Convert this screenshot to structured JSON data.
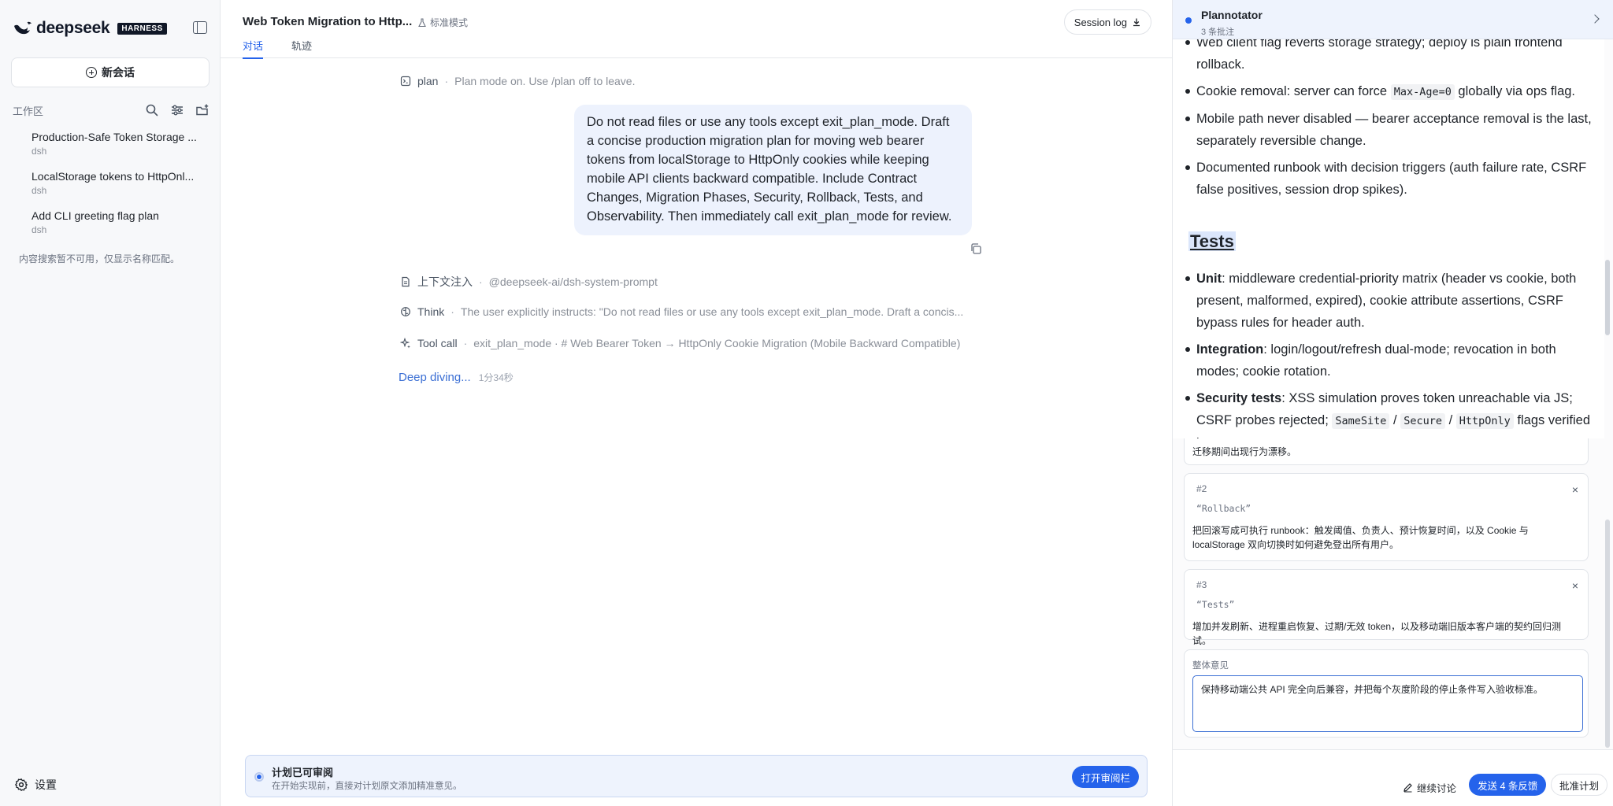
{
  "sidebar": {
    "brand_name": "deepseek",
    "brand_badge": "HARNESS",
    "new_chat_label": "新会话",
    "workspace_label": "工作区",
    "sessions": [
      {
        "title": "Production-Safe Token Storage ...",
        "sub": "dsh"
      },
      {
        "title": "LocalStorage tokens to HttpOnl...",
        "sub": "dsh"
      },
      {
        "title": "Add CLI greeting flag plan",
        "sub": "dsh"
      }
    ],
    "search_note": "内容搜索暂不可用，仅显示名称匹配。",
    "settings_label": "设置"
  },
  "main": {
    "title": "Web Token Migration to Http...",
    "mode": "标准模式",
    "session_log": "Session log",
    "tabs": [
      {
        "label": "对话"
      },
      {
        "label": "轨迹"
      }
    ],
    "plan": {
      "tag": "plan",
      "text": "Plan mode on. Use /plan off to leave."
    },
    "user_message": "Do not read files or use any tools except exit_plan_mode. Draft a concise production migration plan for moving web bearer tokens from localStorage to HttpOnly cookies while keeping mobile API clients backward compatible. Include Contract Changes, Migration Phases, Security, Rollback, Tests, and Observability. Then immediately call exit_plan_mode for review.",
    "steps": [
      {
        "tag": "上下文注入",
        "value": "@deepseek-ai/dsh-system-prompt"
      },
      {
        "tag": "Think",
        "value": "The user explicitly instructs: \"Do not read files or use any tools except exit_plan_mode. Draft a concis..."
      },
      {
        "tag": "Tool call",
        "value": "exit_plan_mode · # Web Bearer Token → HttpOnly Cookie Migration (Mobile Backward Compatible)"
      }
    ],
    "deep_label": "Deep diving...",
    "deep_time": "1分34秒",
    "review": {
      "title": "计划已可审阅",
      "sub": "在开始实现前，直接对计划原文添加精准意见。",
      "button": "打开审阅栏"
    }
  },
  "panel": {
    "title": "Plannotator",
    "sub": "3 条批注",
    "doc": {
      "rollback_items": [
        {
          "text": "Web client flag reverts storage strategy; deploy is plain frontend rollback."
        },
        {
          "pre": "Cookie removal: server can force ",
          "code": "Max-Age=0",
          "post": " globally via ops flag."
        },
        {
          "text": "Mobile path never disabled — bearer acceptance removal is the last, separately reversible change."
        },
        {
          "text": "Documented runbook with decision triggers (auth failure rate, CSRF false positives, session drop spikes)."
        }
      ],
      "tests_heading": "Tests",
      "tests_items": [
        {
          "bold": "Unit",
          "text": ": middleware credential-priority matrix (header vs cookie, both present, malformed, expired), cookie attribute assertions, CSRF bypass rules for header auth."
        },
        {
          "bold": "Integration",
          "text": ": login/logout/refresh dual-mode; revocation in both modes; cookie rotation."
        },
        {
          "bold": "Security tests",
          "text": ": XSS simulation proves token unreachable via JS; CSRF probes rejected; ",
          "codes": [
            "SameSite",
            "Secure",
            "HttpOnly"
          ],
          "sep": "/",
          "post": " flags verified in"
        }
      ]
    },
    "comments": {
      "partial_text": "迁移期间出现行为漂移。",
      "items": [
        {
          "num": "#2",
          "quote": "“Rollback”",
          "body": "把回滚写成可执行 runbook：触发阈值、负责人、预计恢复时间，以及 Cookie 与 localStorage 双向切换时如何避免登出所有用户。"
        },
        {
          "num": "#3",
          "quote": "“Tests”",
          "body": "增加并发刷新、进程重启恢复、过期/无效 token，以及移动端旧版本客户端的契约回归测试。"
        }
      ],
      "close": "×"
    },
    "overall_label": "整体意见",
    "overall_value": "保持移动端公共 API 完全向后兼容，并把每个灰度阶段的停止条件写入验收标准。",
    "actions": {
      "discuss": "继续讨论",
      "send": "发送 4 条反馈",
      "approve": "批准计划"
    }
  },
  "colors": {
    "accent": "#2563eb",
    "bubble": "#edf2fd",
    "sidebar_bg": "#f7f8fa"
  }
}
